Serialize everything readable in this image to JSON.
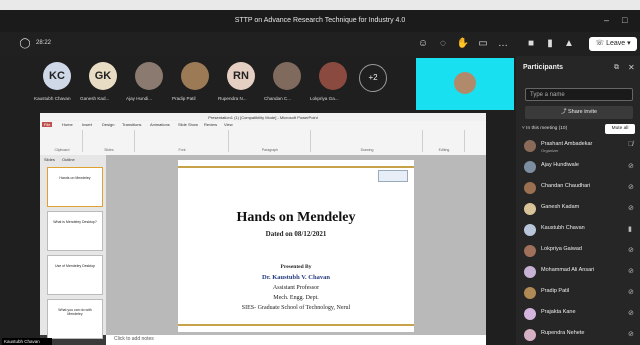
{
  "window": {
    "title": "STTP on Advance Research Technique for Industry 4.0"
  },
  "toolbar": {
    "timer": "28:22",
    "leave_label": "Leave"
  },
  "strip": {
    "participants": [
      {
        "initials": "KC",
        "name": "Kaustubh Chavan",
        "color": "#cfd8e6"
      },
      {
        "initials": "GK",
        "name": "Ganesh Kad...",
        "color": "#e9dcc4"
      },
      {
        "initials": "",
        "name": "Ajay Hundi...",
        "color": "#8a7a70"
      },
      {
        "initials": "",
        "name": "Pradip Patil",
        "color": "#9b7a55"
      },
      {
        "initials": "RN",
        "name": "Rupendra N...",
        "color": "#e5cfc3"
      },
      {
        "initials": "",
        "name": "Chandan C...",
        "color": "#7f6a5d"
      },
      {
        "initials": "",
        "name": "Lokpriya Ga...",
        "color": "#8b4a3f"
      }
    ],
    "more_label": "+2"
  },
  "ppt": {
    "title": "Presentation1 (1) [Compatibility Mode] - Microsoft PowerPoint",
    "tabs": [
      "File",
      "Home",
      "Insert",
      "Design",
      "Transitions",
      "Animations",
      "Slide Show",
      "Review",
      "View"
    ],
    "groups": [
      "Clipboard",
      "Slides",
      "Font",
      "Paragraph",
      "Drawing",
      "Editing"
    ],
    "panel_tabs": [
      "Slides",
      "Outline"
    ],
    "thumbs": [
      "Hands on Mendeley",
      "What is Mendeley Desktop?",
      "Use of Mendeley Desktop",
      "What you can do with Mendeley"
    ],
    "notes_placeholder": "Click to add notes"
  },
  "slide": {
    "title": "Hands on Mendeley",
    "date": "Dated on 08/12/2021",
    "presented_by": "Presented By",
    "presenter": "Dr. Kaustubh V. Chavan",
    "designation": "Assistant Professor",
    "dept": "Mech. Engg. Dept.",
    "institute": "SIES- Graduate School of Technology, Nerul"
  },
  "name_tag": "Kaustubh Chavan",
  "panel": {
    "header": "Participants",
    "search_placeholder": "Type a name",
    "share_invite": "Share invite",
    "meeting_line": "In this meeting (10)",
    "mute_all": "Mute all",
    "people": [
      {
        "name": "Prashant Ambadekar",
        "role": "Organizer",
        "color": "#8a6b5a"
      },
      {
        "name": "Ajay Hundiwale",
        "role": "",
        "color": "#7d8ea0"
      },
      {
        "name": "Chandan Chaudhari",
        "role": "",
        "color": "#9a7050"
      },
      {
        "name": "Ganesh Kadam",
        "role": "",
        "color": "#d9c49a"
      },
      {
        "name": "Kaustubh Chavan",
        "role": "",
        "color": "#b9c6da"
      },
      {
        "name": "Lokpriya Gaiwad",
        "role": "",
        "color": "#a0705a"
      },
      {
        "name": "Mohammad Ali Ansari",
        "role": "",
        "color": "#c7b2d6"
      },
      {
        "name": "Pradip Patil",
        "role": "",
        "color": "#b08a55"
      },
      {
        "name": "Prajakta Kane",
        "role": "",
        "color": "#d2b4dc"
      },
      {
        "name": "Rupendra Nehete",
        "role": "",
        "color": "#d6b0c4"
      }
    ]
  }
}
